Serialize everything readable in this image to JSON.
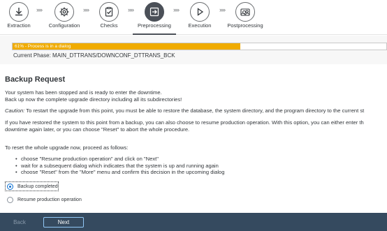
{
  "roadmap": {
    "steps": [
      {
        "label": "Extraction",
        "icon": "download-icon"
      },
      {
        "label": "Configuration",
        "icon": "gear-icon"
      },
      {
        "label": "Checks",
        "icon": "clipboard-check-icon"
      },
      {
        "label": "Preprocessing",
        "icon": "import-icon",
        "active": true
      },
      {
        "label": "Execution",
        "icon": "play-icon"
      },
      {
        "label": "Postprocessing",
        "icon": "gears-picture-icon"
      }
    ]
  },
  "progress": {
    "percent": 61,
    "text": "61% - Process is in a dialog",
    "phase": "Current Phase: MAIN_DTTRANS/DOWNCONF_DTTRANS_BCK",
    "fill_color": "#f0ab00"
  },
  "content": {
    "title": "Backup Request",
    "p1_line1": "Your system has been stopped and is ready to enter the downtime.",
    "p1_line2": "Back up now the complete upgrade directory including all its subdirectories!",
    "caution_label": "Caution:",
    "caution_text": " To restart the upgrade from this point, you must be able to restore the database, the system directory, and the program directory to the current st",
    "p3_line1": "If you have restored the system to this point from a backup, you can also choose to resume production operation. With this option, you can either enter th",
    "p3_line2": "downtime again later, or you can choose \"Reset\" to abort the whole procedure.",
    "p4": "To reset the whole upgrade now, proceed as follows:",
    "bullets": [
      "choose \"Resume production operation\" and click on \"Next\"",
      "wait for a subsequent dialog which indicates that the system is up and running again",
      "choose \"Reset\" from the \"More\" menu and confirm this decision in the upcoming dialog"
    ],
    "options": [
      {
        "label": "Backup completed",
        "selected": true
      },
      {
        "label": "Resume production operation",
        "selected": false
      }
    ]
  },
  "footer": {
    "back_label": "Back",
    "next_label": "Next"
  }
}
